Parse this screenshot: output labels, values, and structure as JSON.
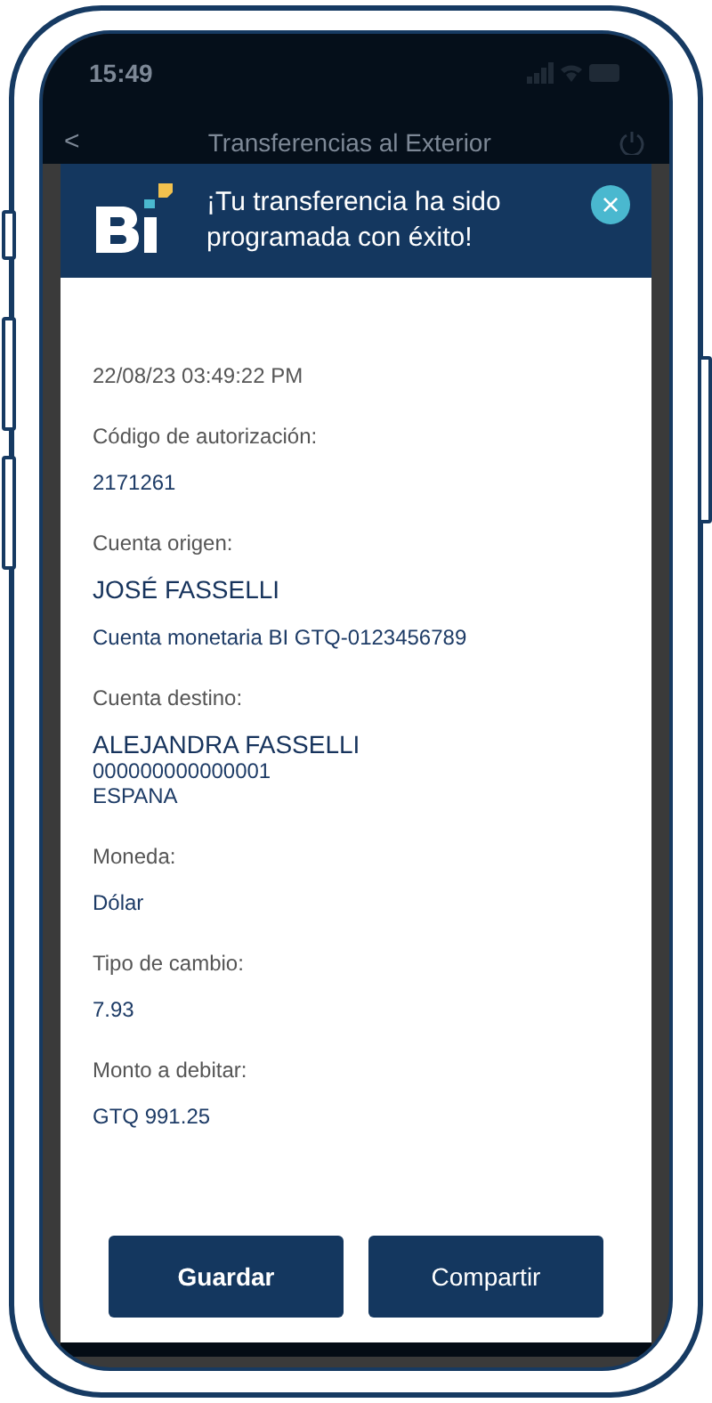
{
  "status_bar": {
    "time": "15:49"
  },
  "nav_bar": {
    "back": "<",
    "title": "Transferencias al Exterior"
  },
  "modal": {
    "title": "¡Tu transferencia ha sido programada con éxito!",
    "close": "×",
    "fields": [
      {
        "kind": "plain",
        "lines": [
          {
            "text": "22/08/23 03:49:22 PM",
            "emphasis": false
          }
        ]
      },
      {
        "kind": "labeled",
        "label": "Código de autorización:",
        "lines": [
          {
            "text": "2171261",
            "emphasis": false
          }
        ]
      },
      {
        "kind": "spaced",
        "label": "Cuenta origen:",
        "lines": [
          {
            "text": "JOSÉ FASSELLI",
            "emphasis": true
          },
          {
            "text": "Cuenta monetaria BI GTQ-0123456789",
            "emphasis": false
          }
        ]
      },
      {
        "kind": "stacked",
        "label": "Cuenta destino:",
        "lines": [
          {
            "text": "ALEJANDRA FASSELLI",
            "emphasis": true
          },
          {
            "text": "000000000000001",
            "emphasis": false
          },
          {
            "text": "ESPANA",
            "emphasis": false
          }
        ]
      },
      {
        "kind": "labeled",
        "label": "Moneda:",
        "lines": [
          {
            "text": "Dólar",
            "emphasis": false
          }
        ]
      },
      {
        "kind": "labeled",
        "label": "Tipo de cambio:",
        "lines": [
          {
            "text": "7.93",
            "emphasis": false
          }
        ]
      },
      {
        "kind": "labeled",
        "label": "Monto a debitar:",
        "lines": [
          {
            "text": "GTQ 991.25",
            "emphasis": false
          }
        ]
      }
    ],
    "buttons": [
      {
        "label": "Guardar",
        "bold": true
      },
      {
        "label": "Compartir",
        "bold": false
      }
    ]
  }
}
